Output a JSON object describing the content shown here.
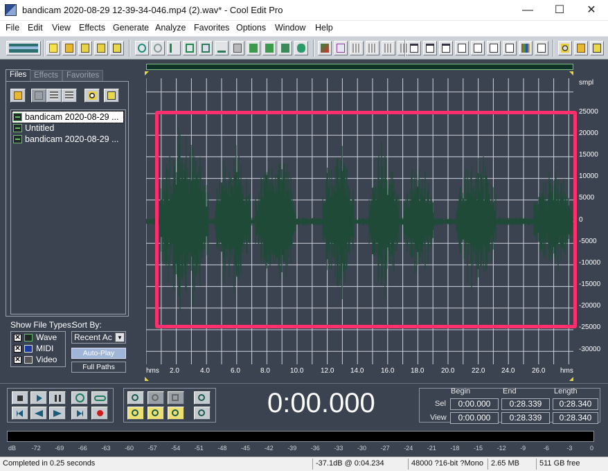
{
  "window": {
    "title": "bandicam 2020-08-29 12-39-34-046.mp4 (2).wav* - Cool Edit Pro",
    "minimize": "—",
    "maximize": "☐",
    "close": "✕"
  },
  "menu": [
    "File",
    "Edit",
    "View",
    "Effects",
    "Generate",
    "Analyze",
    "Favorites",
    "Options",
    "Window",
    "Help"
  ],
  "panel": {
    "tabs": [
      "Files",
      "Effects",
      "Favorites"
    ],
    "files": [
      "bandicam 2020-08-29 ...",
      "Untitled",
      "bandicam 2020-08-29 ..."
    ],
    "show_types_label": "Show File Types:",
    "types": [
      {
        "label": "Wave",
        "checked": true
      },
      {
        "label": "MIDI",
        "checked": true
      },
      {
        "label": "Video",
        "checked": true
      }
    ],
    "sort_label": "Sort By:",
    "sort_value": "Recent Ac",
    "autoplay": "Auto-Play",
    "fullpaths": "Full Paths"
  },
  "waveform": {
    "y_unit": "smpl",
    "y_ticks": [
      "25000",
      "20000",
      "15000",
      "10000",
      "5000",
      "0",
      "-5000",
      "-10000",
      "-15000",
      "-20000",
      "-25000",
      "-30000"
    ],
    "x_ticks": [
      "hms",
      "2.0",
      "4.0",
      "6.0",
      "8.0",
      "10.0",
      "12.0",
      "14.0",
      "16.0",
      "18.0",
      "20.0",
      "22.0",
      "24.0",
      "26.0",
      "hms"
    ],
    "wave_color": "#1f4a38",
    "highlight_color": "#ff2f6d"
  },
  "transport": {
    "time": "0:00.000",
    "headers": [
      "Begin",
      "End",
      "Length"
    ],
    "sel_label": "Sel",
    "view_label": "View",
    "sel": [
      "0:00.000",
      "0:28.339",
      "0:28.340"
    ],
    "view": [
      "0:00.000",
      "0:28.339",
      "0:28.340"
    ]
  },
  "meter": {
    "labels": [
      "dB",
      "-72",
      "-69",
      "-66",
      "-63",
      "-60",
      "-57",
      "-54",
      "-51",
      "-48",
      "-45",
      "-42",
      "-39",
      "-36",
      "-33",
      "-30",
      "-27",
      "-24",
      "-21",
      "-18",
      "-15",
      "-12",
      "-9",
      "-6",
      "-3",
      "0"
    ]
  },
  "status": {
    "message": "Completed in 0.25 seconds",
    "level": "-37.1dB @  0:04.234",
    "format": "48000 ?16-bit ?Mono",
    "size": "2.65 MB",
    "free": "511 GB free"
  }
}
